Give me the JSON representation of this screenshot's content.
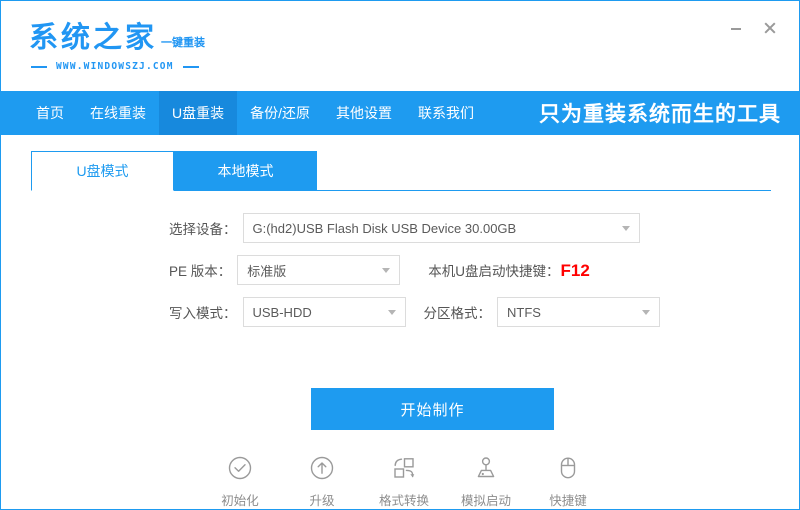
{
  "window": {
    "controls": [
      {
        "name": "minimize",
        "glyph": "minimize-icon"
      },
      {
        "name": "close",
        "glyph": "close-icon"
      }
    ]
  },
  "logo": {
    "title": "系统之家",
    "subtitle": "一键重装",
    "url": "WWW.WINDOWSZJ.COM"
  },
  "nav": {
    "items": [
      {
        "label": "首页",
        "active": false
      },
      {
        "label": "在线重装",
        "active": false
      },
      {
        "label": "U盘重装",
        "active": true
      },
      {
        "label": "备份/还原",
        "active": false
      },
      {
        "label": "其他设置",
        "active": false
      },
      {
        "label": "联系我们",
        "active": false
      }
    ],
    "slogan": "只为重装系统而生的工具"
  },
  "tabs": [
    {
      "label": "U盘模式",
      "selected": true
    },
    {
      "label": "本地模式",
      "selected": false
    }
  ],
  "form": {
    "device": {
      "label": "选择设备：",
      "value": "G:(hd2)USB Flash Disk USB Device 30.00GB"
    },
    "pe_version": {
      "label": "PE 版本：",
      "value": "标准版"
    },
    "hotkey": {
      "label": "本机U盘启动快捷键：",
      "value": "F12"
    },
    "write_mode": {
      "label": "写入模式：",
      "value": "USB-HDD"
    },
    "partition_format": {
      "label": "分区格式：",
      "value": "NTFS"
    }
  },
  "start_button": {
    "label": "开始制作"
  },
  "actions": [
    {
      "label": "初始化",
      "icon": "check-circle-icon"
    },
    {
      "label": "升级",
      "icon": "arrow-up-circle-icon"
    },
    {
      "label": "格式转换",
      "icon": "format-convert-icon"
    },
    {
      "label": "模拟启动",
      "icon": "joystick-icon"
    },
    {
      "label": "快捷键",
      "icon": "mouse-icon"
    }
  ],
  "colors": {
    "brand_blue": "#1e9bf0",
    "brand_blue_dark": "#1789dd",
    "logo_blue": "#2196f3",
    "alert_red": "#ff0000",
    "field_border": "#dcdcdc",
    "muted_text": "#8d8d8d"
  }
}
